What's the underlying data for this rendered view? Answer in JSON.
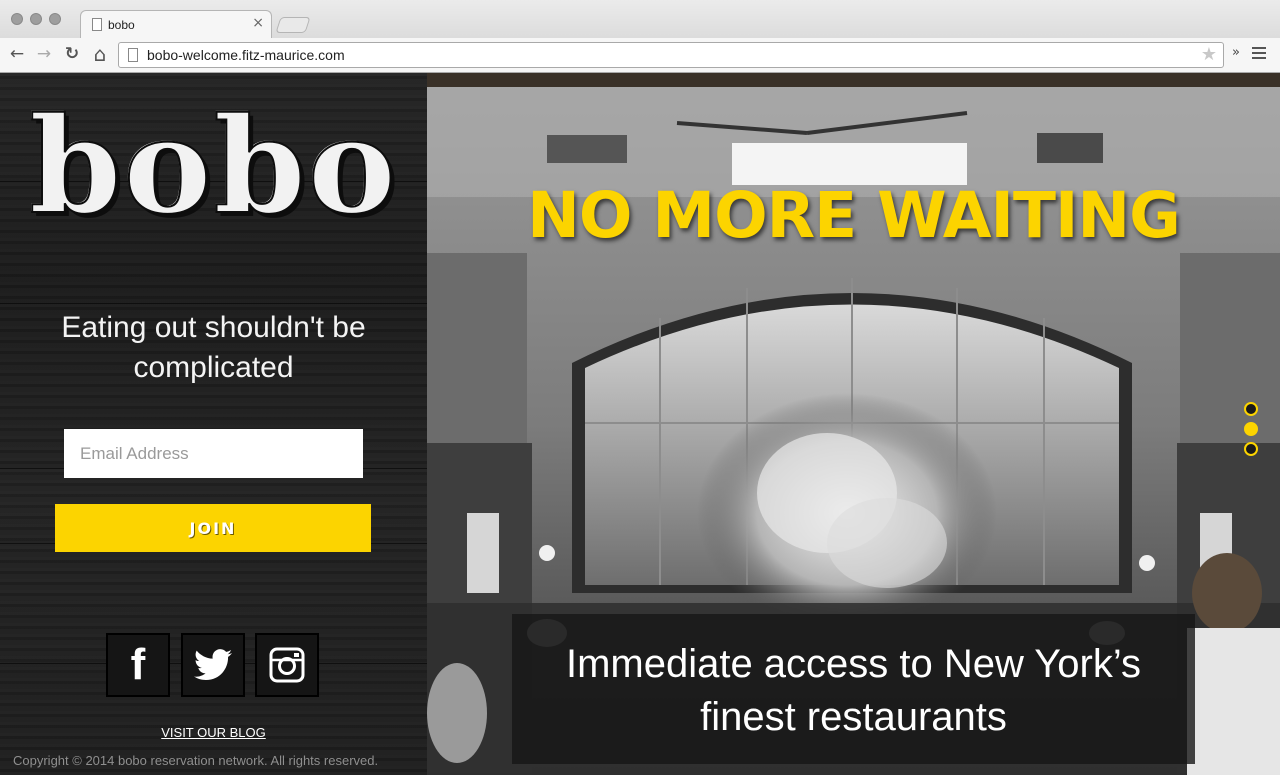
{
  "browser": {
    "tab_title": "bobo",
    "tab_close": "×",
    "url": "bobo-welcome.fitz-maurice.com",
    "back_glyph": "←",
    "forward_glyph": "→",
    "reload_glyph": "↻",
    "home_glyph": "⌂",
    "star_glyph": "★",
    "more_glyph": "»"
  },
  "brand": {
    "logo_text": "bobo",
    "accent_color": "#fcd400"
  },
  "signup": {
    "tagline": "Eating out shouldn't be complicated",
    "email_placeholder": "Email Address",
    "join_label": "JOIN"
  },
  "social": {
    "facebook_glyph": "f",
    "icons": [
      "facebook-icon",
      "twitter-icon",
      "instagram-icon"
    ]
  },
  "footer": {
    "blog_link": "VISIT OUR BLOG",
    "copyright": "Copyright © 2014 bobo reservation network.   All rights reserved."
  },
  "hero": {
    "headline": "NO MORE WAITING",
    "caption": "Immediate access to New York’s finest restaurants",
    "slides_count": 3,
    "active_slide": 2
  }
}
